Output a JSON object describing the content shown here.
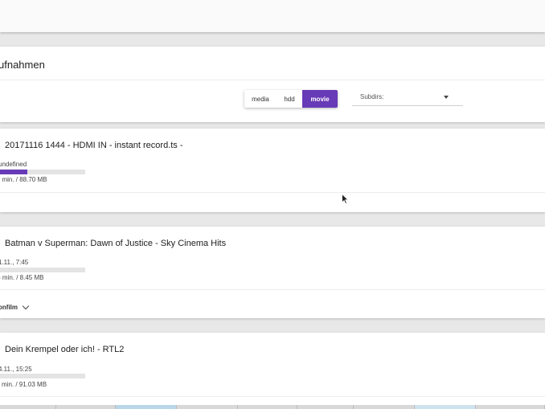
{
  "header": {
    "title": "ufnahmen",
    "toggles": [
      {
        "label": "media",
        "active": false
      },
      {
        "label": "hdd",
        "active": false
      },
      {
        "label": "movie",
        "active": true
      }
    ],
    "subdirs_label": "Subdirs:"
  },
  "recordings": [
    {
      "title": "20171116 1444 - HDMI IN - instant record.ts -",
      "meta": "undefined",
      "size": "/ min. / 88.70 MB",
      "progress": 0.32,
      "category": ""
    },
    {
      "title": "Batman v Superman: Dawn of Justice - Sky Cinema Hits",
      "meta": "1.11., 7:45",
      "size": ") min. / 8.45 MB",
      "progress": 0.0,
      "category": "onfilm"
    },
    {
      "title": "Dein Krempel oder ich! - RTL2",
      "meta": "4.11., 15:25",
      "size": "i min. / 91.03 MB",
      "progress": 0.0,
      "category": ""
    }
  ],
  "colors": {
    "accent": "#673ab7"
  }
}
